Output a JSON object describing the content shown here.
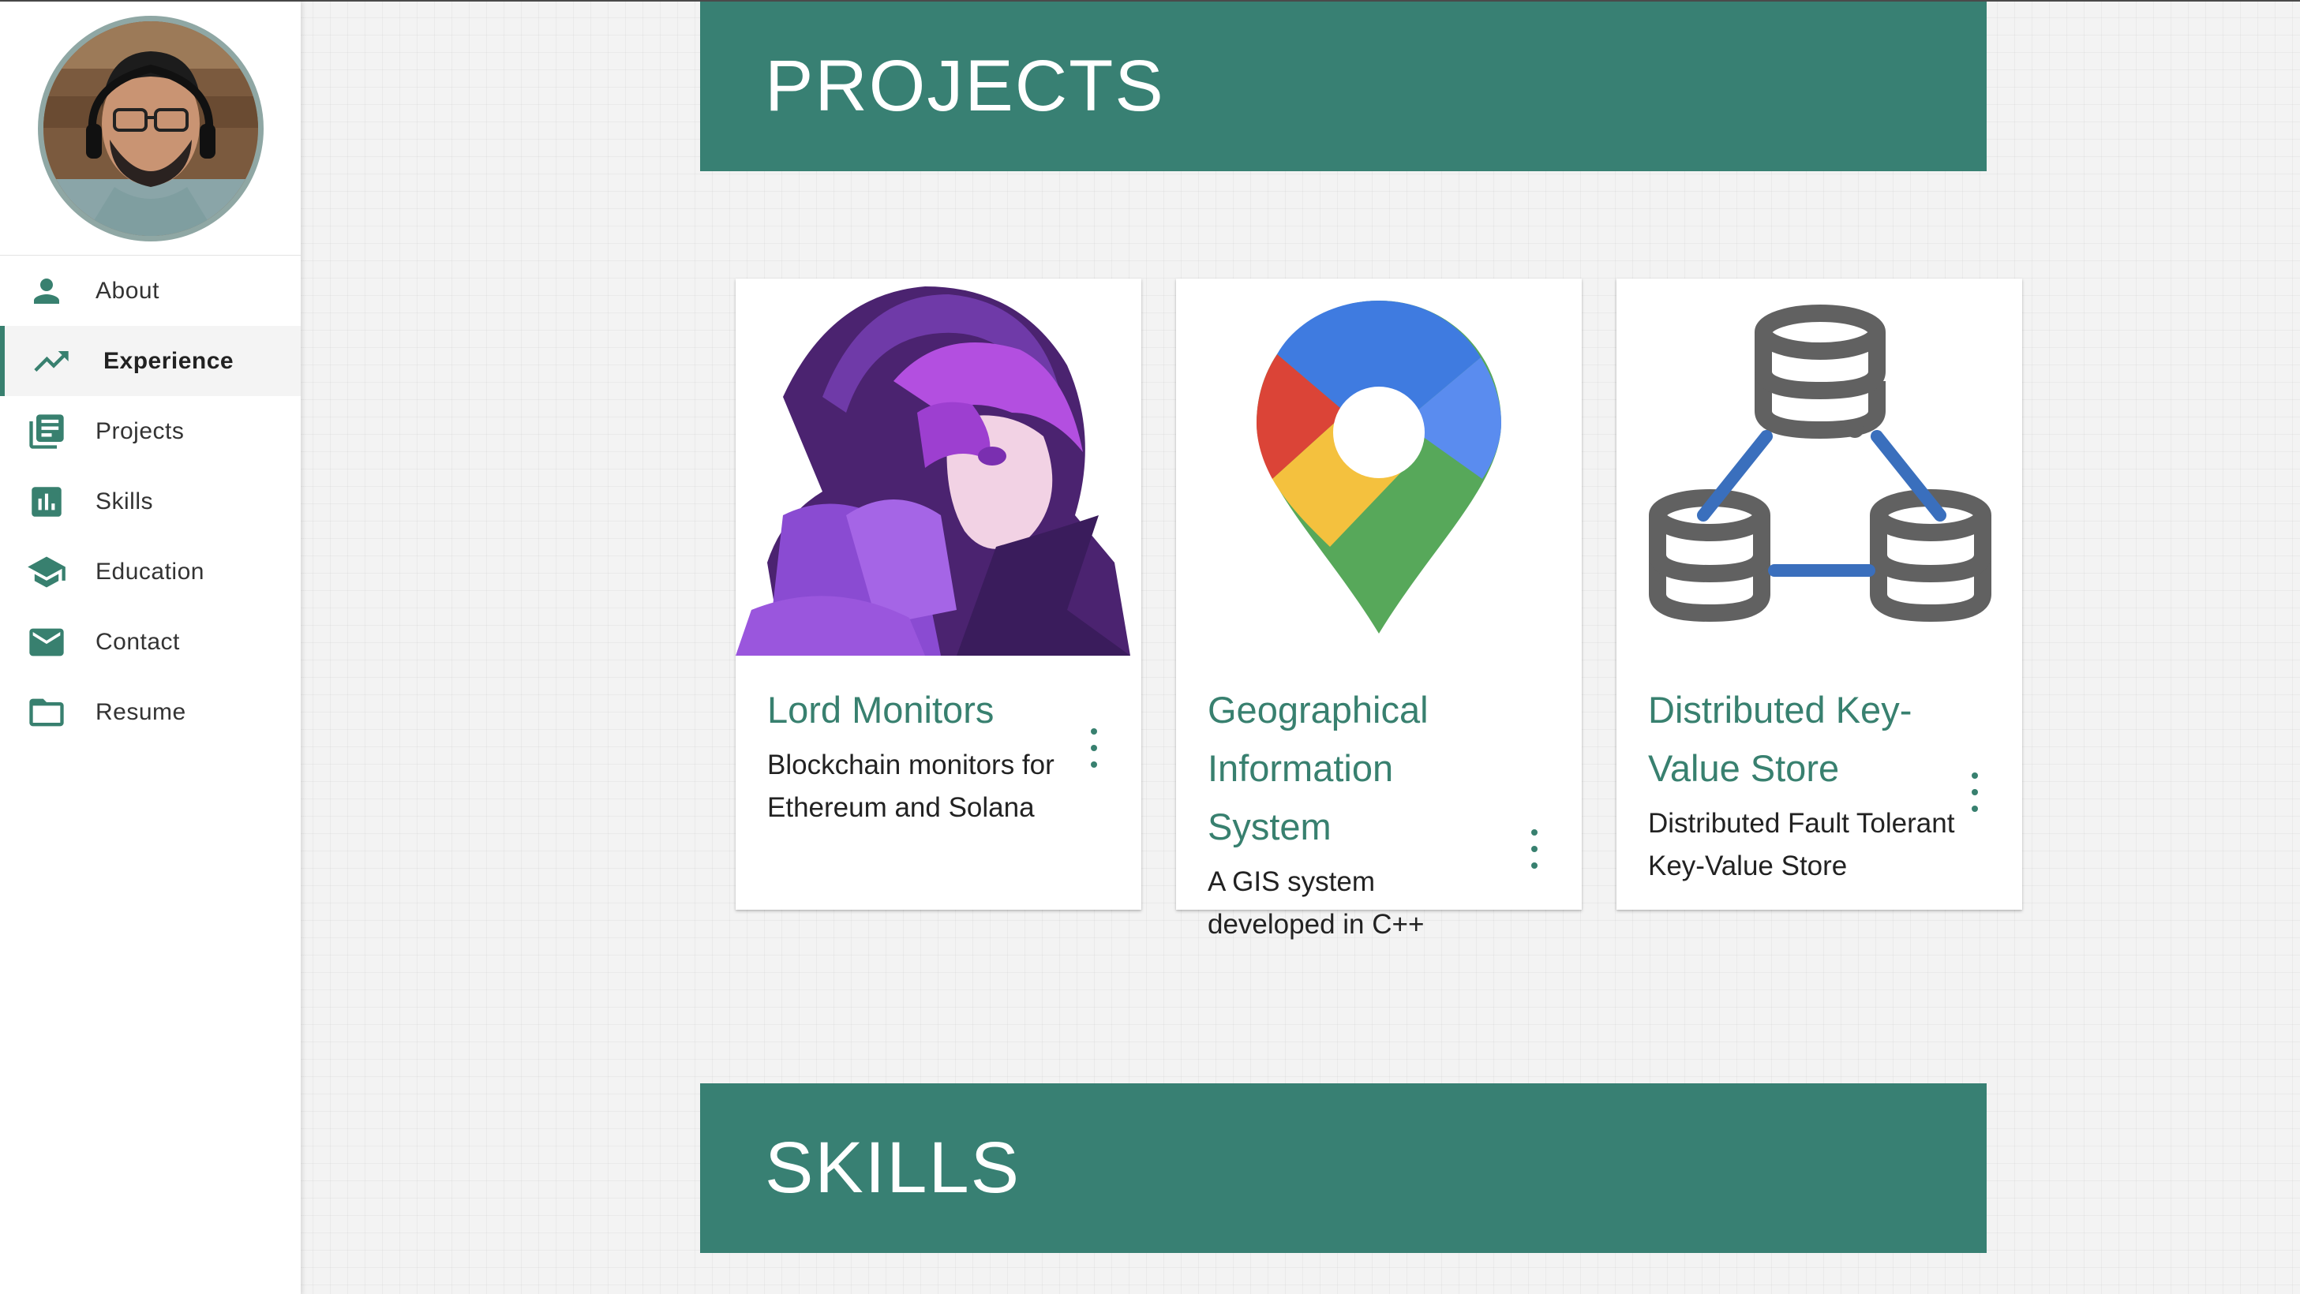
{
  "sidebar": {
    "items": [
      {
        "label": "About",
        "icon": "person-icon"
      },
      {
        "label": "Experience",
        "icon": "trending-up-icon",
        "active": true
      },
      {
        "label": "Projects",
        "icon": "library-books-icon"
      },
      {
        "label": "Skills",
        "icon": "bar-chart-icon"
      },
      {
        "label": "Education",
        "icon": "school-icon"
      },
      {
        "label": "Contact",
        "icon": "mail-icon"
      },
      {
        "label": "Resume",
        "icon": "folder-icon"
      }
    ]
  },
  "sections": {
    "projects_title": "PROJECTS",
    "skills_title": "SKILLS"
  },
  "projects": [
    {
      "title": "Lord Monitors",
      "description": "Blockchain monitors for Ethereum and Solana",
      "image": "anime-character-image"
    },
    {
      "title": "Geographical Information System",
      "description": "A GIS system developed in C++",
      "image": "map-pin-image"
    },
    {
      "title": "Distributed Key-Value Store",
      "description": "Distributed Fault Tolerant Key-Value Store",
      "image": "distributed-database-image"
    }
  ],
  "colors": {
    "accent": "#388073",
    "sidebar_bg": "#ffffff",
    "page_bg": "#f3f3f3"
  }
}
